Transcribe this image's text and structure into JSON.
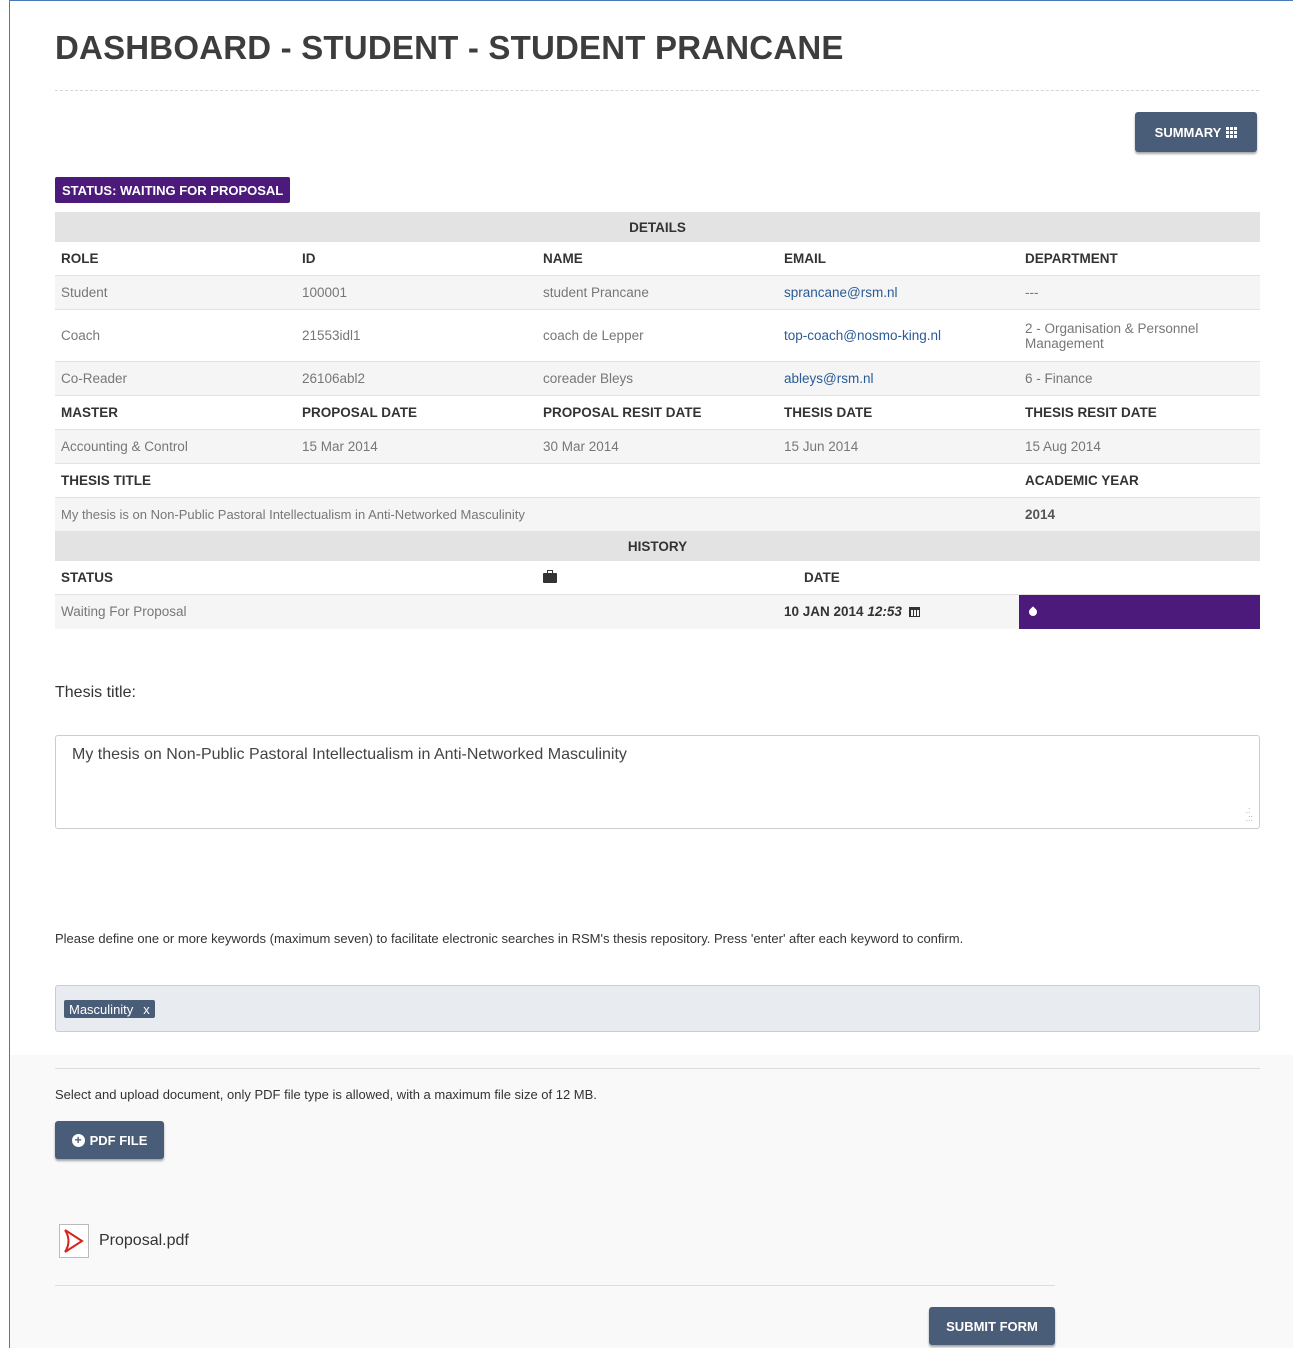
{
  "page": {
    "title": "DASHBOARD - STUDENT - STUDENT PRANCANE"
  },
  "toolbar": {
    "summary_label": "SUMMARY"
  },
  "status_badge": "STATUS: WAITING FOR PROPOSAL",
  "details": {
    "section_title": "DETAILS",
    "people_headers": [
      "ROLE",
      "ID",
      "NAME",
      "EMAIL",
      "DEPARTMENT"
    ],
    "people": [
      {
        "role": "Student",
        "id": "100001",
        "name": "student Prancane",
        "email": "sprancane@rsm.nl",
        "department": "---"
      },
      {
        "role": "Coach",
        "id": "21553idl1",
        "name": "coach de Lepper",
        "email": "top-coach@nosmo-king.nl",
        "department": "2 - Organisation & Personnel Management"
      },
      {
        "role": "Co-Reader",
        "id": "26106abl2",
        "name": "coreader Bleys",
        "email": "ableys@rsm.nl",
        "department": "6 - Finance"
      }
    ],
    "dates_headers": [
      "MASTER",
      "PROPOSAL DATE",
      "PROPOSAL RESIT DATE",
      "THESIS DATE",
      "THESIS RESIT DATE"
    ],
    "dates": {
      "master": "Accounting & Control",
      "proposal_date": "15 Mar 2014",
      "proposal_resit_date": "30 Mar 2014",
      "thesis_date": "15 Jun 2014",
      "thesis_resit_date": "15 Aug 2014"
    },
    "thesis_headers": {
      "thesis_title": "THESIS TITLE",
      "academic_year": "ACADEMIC YEAR"
    },
    "thesis": {
      "title": "My thesis is on Non-Public Pastoral Intellectualism in Anti-Networked Masculinity",
      "academic_year": "2014"
    }
  },
  "history": {
    "section_title": "HISTORY",
    "headers": {
      "status": "STATUS",
      "date": "DATE"
    },
    "rows": [
      {
        "status": "Waiting For Proposal",
        "date": "10 JAN 2014",
        "time": "12:53"
      }
    ]
  },
  "form": {
    "thesis_title_label": "Thesis title:",
    "thesis_title_value": "My thesis on Non-Public Pastoral Intellectualism in Anti-Networked Masculinity",
    "keywords_instructions": "Please define one or more keywords (maximum seven) to facilitate electronic searches in RSM's thesis repository. Press 'enter' after each keyword to confirm.",
    "keywords": [
      "Masculinity"
    ],
    "keyword_remove": "x",
    "upload_instructions": "Select and upload document, only PDF file type is allowed, with a maximum file size of 12 MB.",
    "pdf_button_label": "PDF FILE",
    "uploaded_file": "Proposal.pdf",
    "submit_label": "SUBMIT FORM"
  },
  "colors": {
    "accent_purple": "#4b1a7a",
    "button": "#4a5d78",
    "link": "#2a5b96"
  },
  "icons": [
    "grid-icon",
    "briefcase-icon",
    "calendar-icon",
    "tint-icon",
    "plus-circle-icon",
    "pdf-file-icon"
  ]
}
